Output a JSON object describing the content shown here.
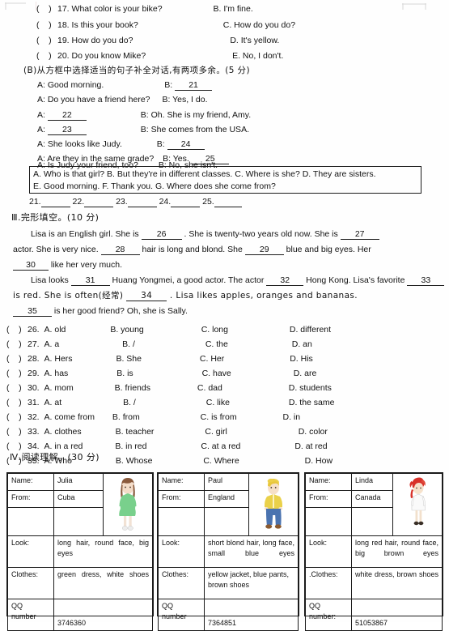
{
  "part_a": {
    "items": [
      {
        "num": "17.",
        "question": "What color is your bike?",
        "answer": "B. I'm fine."
      },
      {
        "num": "18.",
        "question": "Is this your book?",
        "answer": "C. How do you do?"
      },
      {
        "num": "19.",
        "question": "How do you do?",
        "answer": "D. It's yellow."
      },
      {
        "num": "20.",
        "question": "Do you know Mike?",
        "answer": "E. No, I don't."
      }
    ]
  },
  "part_b": {
    "heading": "(B)从方框中选择适当的句子补全对话,有两项多余。(5 分)",
    "dialogue": [
      {
        "a": "A: Good morning.",
        "b_prefix": "B:",
        "b_blank": "21",
        "b_text": ""
      },
      {
        "a": "A: Do you have a friend here?",
        "b_prefix": "B: Yes, I do.",
        "b_blank": "",
        "b_text": ""
      },
      {
        "a": "A:",
        "a_blank": "22",
        "b_prefix": "B: Oh. She is my friend, Amy.",
        "b_blank": "",
        "b_text": ""
      },
      {
        "a": "A:",
        "a_blank": "23",
        "b_prefix": "B: She comes from the USA.",
        "b_blank": "",
        "b_text": ""
      },
      {
        "a": "A: She looks like Judy.",
        "b_prefix": "B:",
        "b_blank": "24",
        "b_text": ""
      },
      {
        "a": "A: Are they in the same grade?",
        "b_prefix": "B: Yes.",
        "b_blank": "25",
        "b_text": ""
      },
      {
        "a": "A: Is Judy your friend, too?",
        "b_prefix": "B: No, she isn't.",
        "b_blank": "",
        "b_text": ""
      }
    ],
    "choice_box": {
      "line1": "A. Who is that  girl?     B. But they're in different classes.    C. Where is she?         D. They are sisters.",
      "line2": "E. Good morning.        F. Thank you.       G. Where does she come from?"
    },
    "answer_line": {
      "n21": "21.",
      "n22": "22.",
      "n23": "23.",
      "n24": "24.",
      "n25": "25."
    }
  },
  "part_3": {
    "heading": "Ⅲ.完形填空。(10 分)",
    "passage": {
      "p1_s1": "Lisa is an English girl. She is",
      "p1_b1": "26",
      "p1_s2": ". She is twenty-two years old now. She is",
      "p1_b2": "27",
      "p1_s3": "actor. She is very nice.",
      "p1_b3": "28",
      "p1_s4": "hair is long and blond. She",
      "p1_b4": "29",
      "p1_s5": "blue and big eyes. Her",
      "p1_b5": "30",
      "p1_s6": "like her very much.",
      "p2_s1": "Lisa looks",
      "p2_b1": "31",
      "p2_s2": "Huang Yongmei, a good actor. The actor",
      "p2_b2": "32",
      "p2_s3": "Hong Kong. Lisa's favorite",
      "p2_b3": "33",
      "p2_s4": "is red. She is often(经常)",
      "p2_b4": "34",
      "p2_s5": ". Lisa  likes apples, oranges and bananas.",
      "p3_b1": "35",
      "p3_s1": "is her good friend? Oh, she is Sally."
    },
    "questions": [
      {
        "num": "26.",
        "a": "A. old",
        "b": "B. young",
        "c": "C. long",
        "d": "D. different"
      },
      {
        "num": "27.",
        "a": "A. a",
        "b": "B. /",
        "c": "C. the",
        "d": "D. an"
      },
      {
        "num": "28.",
        "a": "A. Hers",
        "b": "B. She",
        "c": "C. Her",
        "d": "D. His"
      },
      {
        "num": "29.",
        "a": "A. has",
        "b": "B. is",
        "c": "C. have",
        "d": "D. are"
      },
      {
        "num": "30.",
        "a": "A. mom",
        "b": "B. friends",
        "c": "C. dad",
        "d": "D. students"
      },
      {
        "num": "31.",
        "a": "A. at",
        "b": "B. /",
        "c": "C. like",
        "d": "D. the same"
      },
      {
        "num": "32.",
        "a": "A. come from",
        "b": "B. from",
        "c": "C. is from",
        "d": "D. in"
      },
      {
        "num": "33.",
        "a": "A. clothes",
        "b": "B. teacher",
        "c": "C. girl",
        "d": "D. color"
      },
      {
        "num": "34.",
        "a": "A. in a red",
        "b": "B. in red",
        "c": "C. at a red",
        "d": "D. at red"
      },
      {
        "num": "35.",
        "a": "A. Who",
        "b": "B. Whose",
        "c": "C. Where",
        "d": "D. How"
      }
    ]
  },
  "part_4": {
    "heading": "Ⅳ.阅读理解。(30 分)",
    "cards": [
      {
        "name_label": "Name:",
        "name_value": "Julia",
        "from_label": "From:",
        "from_value": "Cuba",
        "look_label": "Look:",
        "look_value": "long hair, round face, big eyes",
        "clothes_label": "Clothes:",
        "clothes_value": "green dress, white shoes",
        "qq_label_1": "QQ",
        "qq_label_2": "number",
        "qq_value": "3746360",
        "avatar": "girl-green-dress-avatar",
        "colors": {
          "hair": "#8a5a3c",
          "clothes": "#79d08c",
          "skin": "#f4dcc8",
          "shoes": "#e8e8e8"
        }
      },
      {
        "name_label": "Name:",
        "name_value": "Paul",
        "from_label": "From:",
        "from_value": "England",
        "look_label": "Look:",
        "look_value": "short blond hair, long face, small blue eyes",
        "clothes_label": "Clothes:",
        "clothes_value": "yellow jacket, blue pants, brown shoes",
        "qq_label_1": "QQ",
        "qq_label_2": "number",
        "qq_value": "7364851",
        "avatar": "boy-yellow-jacket-avatar",
        "colors": {
          "hair": "#e8c63c",
          "clothes": "#ead14a",
          "pants": "#4a73b0",
          "skin": "#f6e0c8",
          "shoes": "#8a5a30"
        }
      },
      {
        "name_label": "Name:",
        "name_value": "Linda",
        "from_label": "From:",
        "from_value": "Canada",
        "look_label": "Look:",
        "look_value": "long red hair, round face, big brown eyes",
        "clothes_label": ".Clothes:",
        "clothes_value": "white dress, brown shoes",
        "qq_label_1": "QQ",
        "qq_label_2": "number:",
        "qq_value": "51053867",
        "avatar": "girl-red-hair-white-dress-avatar",
        "colors": {
          "hair": "#d8322a",
          "clothes": "#fafafa",
          "skin": "#f6e2cc",
          "shoes": "#3a3027"
        }
      }
    ]
  }
}
